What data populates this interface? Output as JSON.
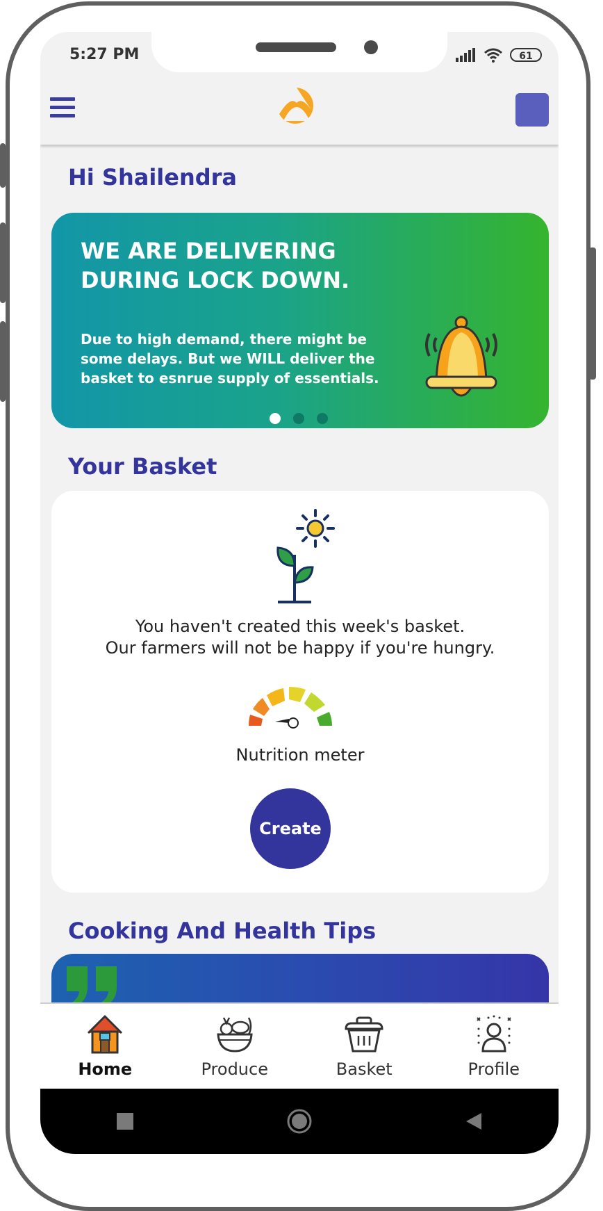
{
  "status_bar": {
    "time": "5:27 PM",
    "battery": "61",
    "icons": [
      "signal-icon",
      "wifi-icon",
      "battery-icon"
    ]
  },
  "header": {
    "icons": [
      "menu-icon",
      "logo-icon",
      "avatar"
    ]
  },
  "greeting": "Hi Shailendra",
  "banner": {
    "title": "WE ARE DELIVERING DURING LOCK DOWN.",
    "text": "Due to high demand, there might be some delays. But we WILL deliver the basket to esnrue supply of essentials.",
    "slides": 3,
    "active_slide": 1,
    "icon": "bell-icon"
  },
  "basket": {
    "title": "Your Basket",
    "message_line1": "You haven't created this week's basket.",
    "message_line2": "Our farmers will not be happy if you're hungry.",
    "meter_label": "Nutrition meter",
    "create_label": "Create",
    "icons": [
      "plant-sun-icon",
      "nutrition-meter-icon"
    ]
  },
  "tips": {
    "title": "Cooking And Health Tips",
    "icon": "quote-icon"
  },
  "nav": {
    "items": [
      {
        "label": "Home",
        "icon": "home-icon",
        "active": true
      },
      {
        "label": "Produce",
        "icon": "produce-basket-icon",
        "active": false
      },
      {
        "label": "Basket",
        "icon": "basket-icon",
        "active": false
      },
      {
        "label": "Profile",
        "icon": "profile-icon",
        "active": false
      }
    ]
  },
  "colors": {
    "brand": "#33349c",
    "banner_start": "#1296a8",
    "banner_end": "#35b42e",
    "logo": "#f5a623",
    "home_icon": "#f7941d"
  }
}
